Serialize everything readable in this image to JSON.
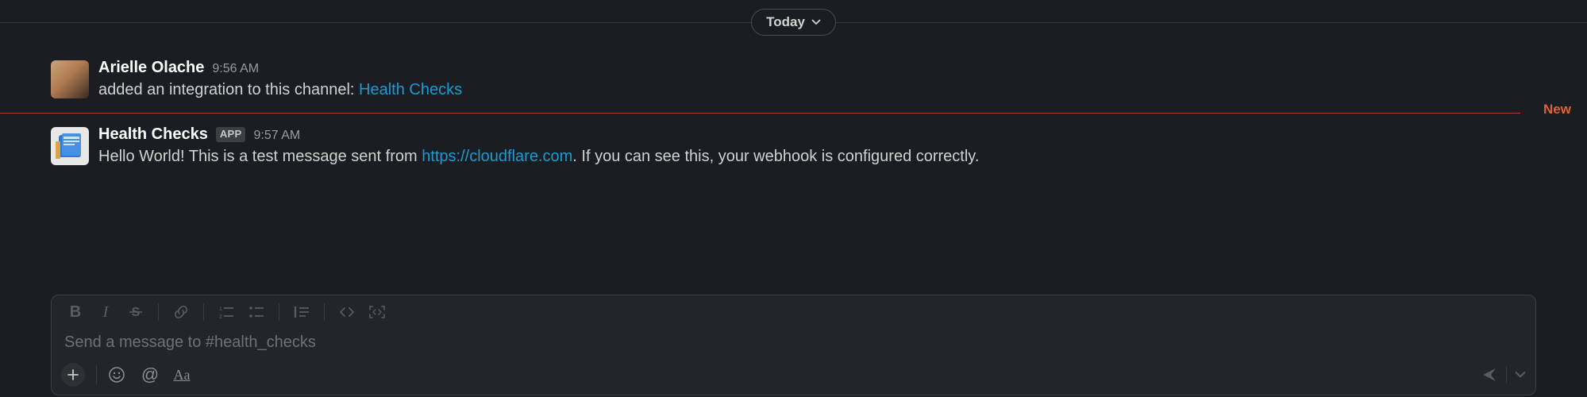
{
  "divider": {
    "date_label": "Today",
    "new_label": "New"
  },
  "messages": [
    {
      "author": "Arielle Olache",
      "time": "9:56 AM",
      "is_app": false,
      "text_prefix": "added an integration to this channel: ",
      "link_text": "Health Checks",
      "text_suffix": ""
    },
    {
      "author": "Health Checks",
      "time": "9:57 AM",
      "is_app": true,
      "app_badge": "APP",
      "text_prefix": "Hello World! This is a test message sent from ",
      "link_text": "https://cloudflare.com",
      "text_suffix": ". If you can see this, your webhook is configured correctly."
    }
  ],
  "composer": {
    "placeholder": "Send a message to #health_checks"
  },
  "toolbar": {
    "bold": "B",
    "italic": "I",
    "mention": "@",
    "aa": "Aa"
  }
}
